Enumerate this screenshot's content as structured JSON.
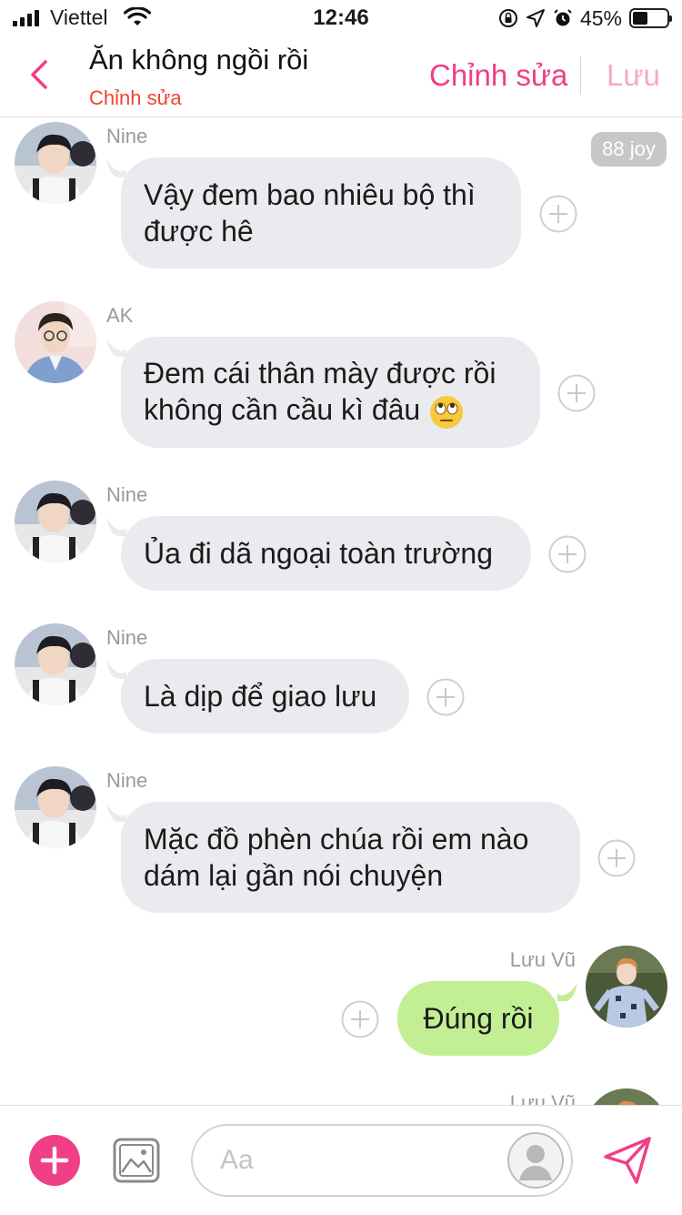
{
  "status_bar": {
    "carrier": "Viettel",
    "time": "12:46",
    "battery_percent": "45%",
    "battery_level": 0.45
  },
  "header": {
    "title": "Ăn không ngồi rồi",
    "subtitle": "Chỉnh sửa",
    "edit_label": "Chỉnh sửa",
    "save_label": "Lưu"
  },
  "chat": {
    "joy_badge": "88 joy",
    "messages": [
      {
        "sender": "Nine",
        "lines": [
          "Vậy đem bao nhiêu bộ thì",
          "được hê"
        ]
      },
      {
        "sender": "AK",
        "lines": [
          "Đem cái thân mày được rồi",
          "không cần cầu kì đâu"
        ],
        "emoji": "face-with-rolling-eyes"
      },
      {
        "sender": "Nine",
        "lines": [
          "Ủa đi dã ngoại toàn trường"
        ]
      },
      {
        "sender": "Nine",
        "lines": [
          "Là dịp để giao lưu"
        ]
      },
      {
        "sender": "Nine",
        "lines": [
          "Mặc đồ phèn chúa rồi em nào",
          "dám lại gần nói chuyện"
        ]
      },
      {
        "sender": "Lưu Vũ",
        "lines": [
          "Đúng rồi"
        ],
        "outgoing": true
      },
      {
        "sender": "Lưu Vũ",
        "lines": [],
        "outgoing": true
      }
    ]
  },
  "composer": {
    "placeholder": "Aa"
  },
  "colors": {
    "accent": "#ef3f86",
    "subtitle": "#f0422d",
    "incoming_bubble": "#e9ebee",
    "outgoing_bubble": "#c3ef94"
  }
}
